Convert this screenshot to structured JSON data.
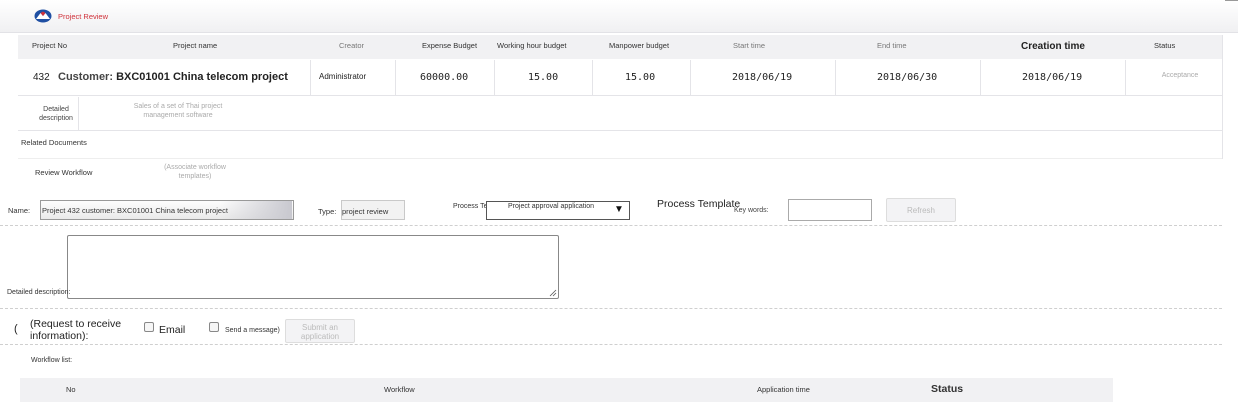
{
  "app": {
    "title": "Project Review"
  },
  "project_table": {
    "columns": [
      "Project No",
      "Project name",
      "Creator",
      "Expense Budget",
      "Working hour budget",
      "Manpower budget",
      "Start time",
      "End time",
      "Creation time",
      "Status"
    ],
    "row": {
      "project_no": "432",
      "name_prefix": "Customer:",
      "name": "BXC01001 China telecom project",
      "creator": "Administrator",
      "expense_budget": "60000.00",
      "working_hour_budget": "15.00",
      "manpower_budget": "15.00",
      "start_time": "2018/06/19",
      "end_time": "2018/06/30",
      "creation_time": "2018/06/19",
      "status": "Acceptance"
    },
    "detail_label": "Detailed description",
    "detail_value": "Sales of a set of Thai project management software"
  },
  "related_documents_label": "Related Documents",
  "review_workflow": {
    "label": "Review Workflow",
    "associate_link": "(Associate workflow templates)"
  },
  "form": {
    "name_label": "Name:",
    "name_value": "Project 432 customer: BXC01001 China telecom project",
    "type_label": "Type:",
    "type_value": "project review",
    "process_template_label": "Process Template:",
    "process_template_value": "Project approval application",
    "process_template_heading": "Process Template",
    "keywords_label": "Key words:",
    "keywords_value": "",
    "refresh_label": "Refresh",
    "detailed_description_label": "Detailed description:",
    "detailed_description_value": "",
    "paren_open": "(",
    "request_label": "(Request to receive information):",
    "email_label": "Email",
    "send_message_label": "Send a message)",
    "submit_label": "Submit an application"
  },
  "workflow_list": {
    "label": "Workflow list:",
    "columns": [
      "No",
      "Workflow",
      "Application time",
      "Status"
    ]
  }
}
